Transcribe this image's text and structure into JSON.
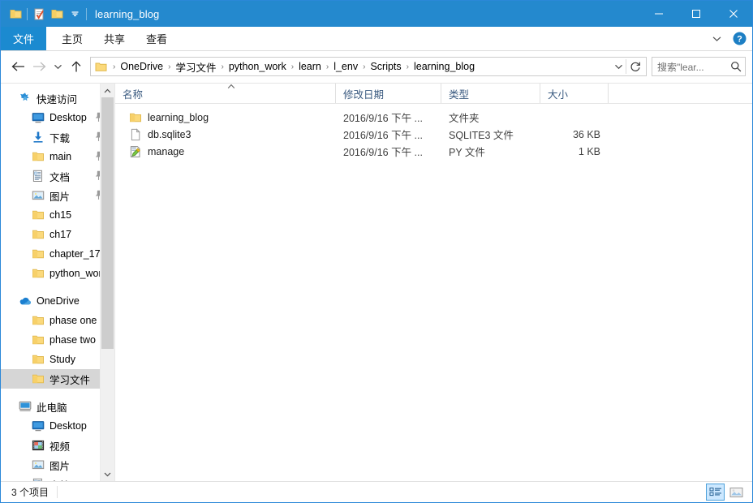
{
  "window": {
    "title": "learning_blog",
    "quick_access_buttons": [
      "folder-icon",
      "properties-icon",
      "new-folder-icon",
      "customize-dropdown-icon"
    ],
    "controls": {
      "minimize": "minimize-icon",
      "maximize": "maximize-icon",
      "close": "close-icon"
    }
  },
  "ribbon": {
    "tabs": [
      {
        "label": "文件",
        "active": true
      },
      {
        "label": "主页",
        "active": false
      },
      {
        "label": "共享",
        "active": false
      },
      {
        "label": "查看",
        "active": false
      }
    ],
    "expand_icon": "chevron-down-icon",
    "help_icon": "help-icon"
  },
  "address": {
    "back_icon": "back-arrow-icon",
    "forward_icon": "forward-arrow-icon",
    "recent_icon": "chevron-down-icon",
    "up_icon": "up-arrow-icon",
    "breadcrumbs": [
      "OneDrive",
      "学习文件",
      "python_work",
      "learn",
      "l_env",
      "Scripts",
      "learning_blog"
    ],
    "separator": "›",
    "dropdown_icon": "chevron-down-icon",
    "refresh_icon": "refresh-icon"
  },
  "search": {
    "placeholder": "搜索\"lear...",
    "value": "",
    "icon": "search-icon"
  },
  "sidebar": {
    "scroll_up_icon": "chevron-up-icon",
    "scroll_down_icon": "chevron-down-icon",
    "items": [
      {
        "label": "快速访问",
        "icon": "star-icon",
        "level": 0,
        "pinned": false,
        "selected": false
      },
      {
        "label": "Desktop",
        "icon": "desktop-icon",
        "level": 1,
        "pinned": true,
        "selected": false
      },
      {
        "label": "下载",
        "icon": "downloads-icon",
        "level": 1,
        "pinned": true,
        "selected": false
      },
      {
        "label": "main",
        "icon": "folder-icon",
        "level": 1,
        "pinned": true,
        "selected": false
      },
      {
        "label": "文档",
        "icon": "documents-icon",
        "level": 1,
        "pinned": true,
        "selected": false
      },
      {
        "label": "图片",
        "icon": "pictures-icon",
        "level": 1,
        "pinned": true,
        "selected": false
      },
      {
        "label": "ch15",
        "icon": "folder-icon",
        "level": 1,
        "pinned": false,
        "selected": false
      },
      {
        "label": "ch17",
        "icon": "folder-icon",
        "level": 1,
        "pinned": false,
        "selected": false
      },
      {
        "label": "chapter_17",
        "icon": "folder-icon",
        "level": 1,
        "pinned": false,
        "selected": false
      },
      {
        "label": "python_work",
        "icon": "folder-icon",
        "level": 1,
        "pinned": false,
        "selected": false
      },
      {
        "label": "",
        "icon": "spacer",
        "level": 0,
        "pinned": false,
        "selected": false
      },
      {
        "label": "OneDrive",
        "icon": "onedrive-icon",
        "level": 0,
        "pinned": false,
        "selected": false
      },
      {
        "label": "phase one",
        "icon": "folder-icon",
        "level": 1,
        "pinned": false,
        "selected": false
      },
      {
        "label": "phase two",
        "icon": "folder-icon",
        "level": 1,
        "pinned": false,
        "selected": false
      },
      {
        "label": "Study",
        "icon": "folder-icon",
        "level": 1,
        "pinned": false,
        "selected": false
      },
      {
        "label": "学习文件",
        "icon": "folder-icon",
        "level": 1,
        "pinned": false,
        "selected": true
      },
      {
        "label": "",
        "icon": "spacer",
        "level": 0,
        "pinned": false,
        "selected": false
      },
      {
        "label": "此电脑",
        "icon": "computer-icon",
        "level": 0,
        "pinned": false,
        "selected": false
      },
      {
        "label": "Desktop",
        "icon": "desktop-icon",
        "level": 1,
        "pinned": false,
        "selected": false
      },
      {
        "label": "视频",
        "icon": "videos-icon",
        "level": 1,
        "pinned": false,
        "selected": false
      },
      {
        "label": "图片",
        "icon": "pictures-icon",
        "level": 1,
        "pinned": false,
        "selected": false
      },
      {
        "label": "文档",
        "icon": "documents-icon",
        "level": 1,
        "pinned": false,
        "selected": false
      }
    ]
  },
  "filelist": {
    "columns": [
      {
        "label": "名称",
        "sorted": true,
        "sort_dir": "asc"
      },
      {
        "label": "修改日期",
        "sorted": false
      },
      {
        "label": "类型",
        "sorted": false
      },
      {
        "label": "大小",
        "sorted": false
      }
    ],
    "rows": [
      {
        "name": "learning_blog",
        "icon": "folder-icon",
        "date": "2016/9/16 下午 ...",
        "type": "文件夹",
        "size": ""
      },
      {
        "name": "db.sqlite3",
        "icon": "generic-file-icon",
        "date": "2016/9/16 下午 ...",
        "type": "SQLITE3 文件",
        "size": "36 KB"
      },
      {
        "name": "manage",
        "icon": "python-file-icon",
        "date": "2016/9/16 下午 ...",
        "type": "PY 文件",
        "size": "1 KB"
      }
    ]
  },
  "statusbar": {
    "item_count": "3 个项目",
    "views": [
      {
        "name": "details-view",
        "active": true
      },
      {
        "name": "large-icons-view",
        "active": false
      }
    ]
  },
  "colors": {
    "titlebar": "#2489ce",
    "file_tab": "#1b8ad0",
    "selection": "#d6d6d6",
    "folder": "#fdd97f",
    "accent_text": "#3a5a80"
  }
}
